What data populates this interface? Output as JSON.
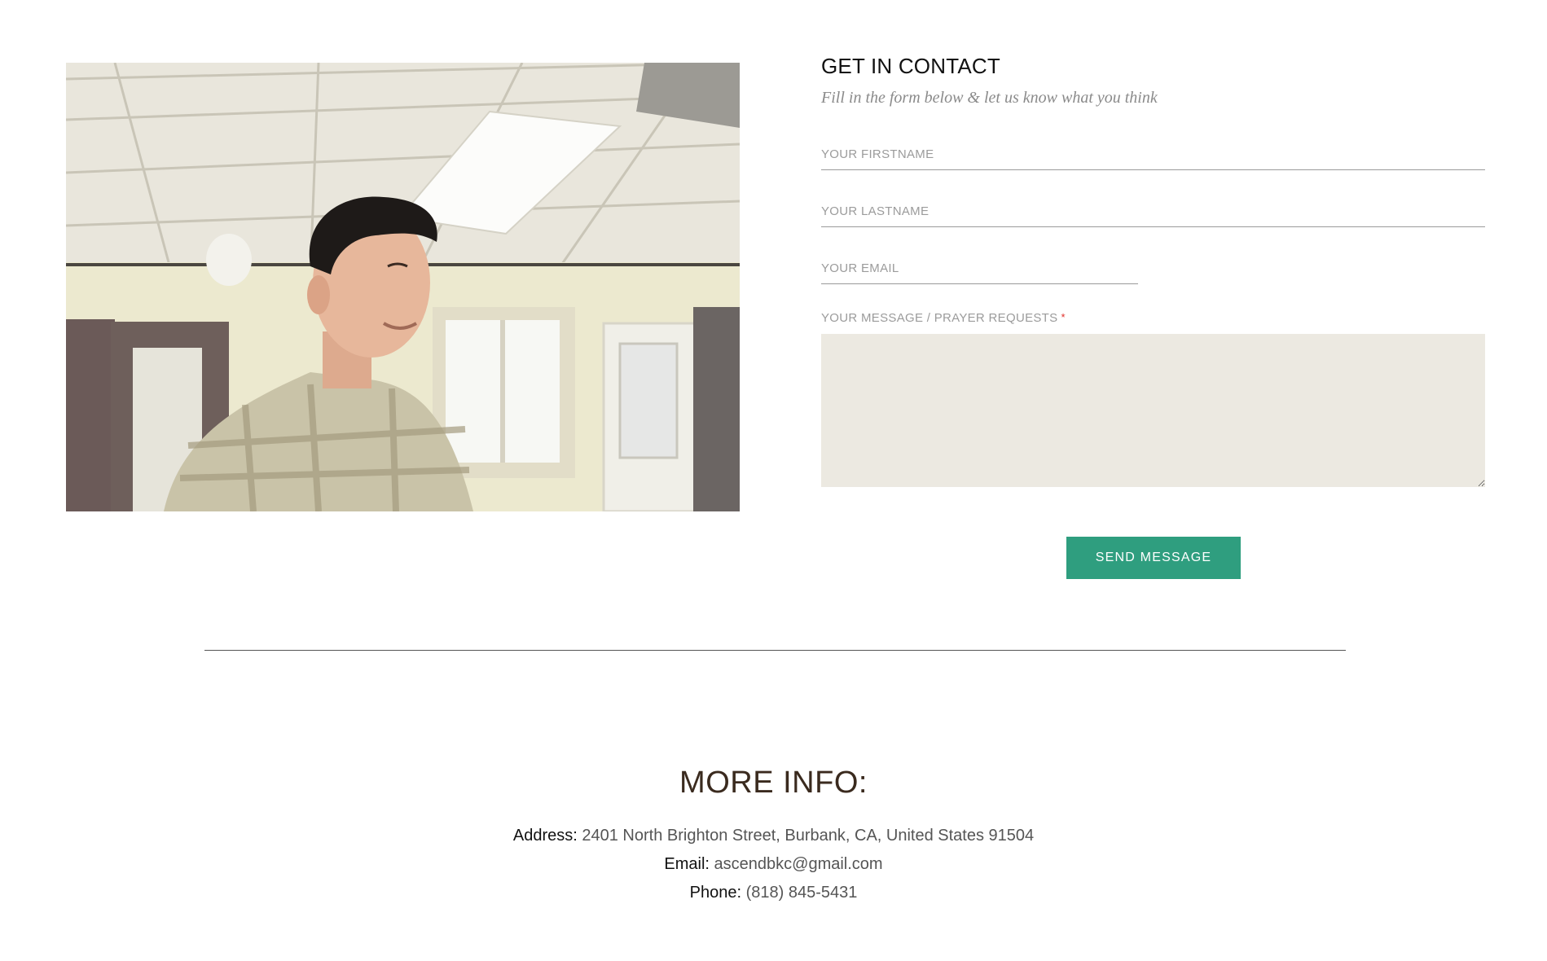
{
  "photo": {
    "alt": "Smiling man in plaid shirt in a bright room",
    "colors": {
      "ceiling": "#e9e6dc",
      "wall": "#ece9cf",
      "shirt": "#c9c3a8",
      "hair": "#1e1a18",
      "skin": "#e7b79b",
      "door": "#6b5a58"
    }
  },
  "contact": {
    "title": "GET IN CONTACT",
    "subtitle": "Fill in the form below & let us know what you think",
    "firstname_placeholder": "YOUR FIRSTNAME",
    "lastname_placeholder": "YOUR LASTNAME",
    "email_placeholder": "YOUR EMAIL",
    "message_label": "YOUR MESSAGE / PRAYER REQUESTS",
    "required_mark": "*",
    "message_value": "",
    "send_label": "SEND MESSAGE",
    "accent_color": "#2f9e7f"
  },
  "more_info": {
    "title": "MORE INFO:",
    "address_label": "Address:",
    "address_value": "2401 North Brighton Street, Burbank, CA, United States 91504",
    "email_label": "Email:",
    "email_value": "ascendbkc@gmail.com",
    "phone_label": "Phone:",
    "phone_value": "(818) 845-5431"
  }
}
